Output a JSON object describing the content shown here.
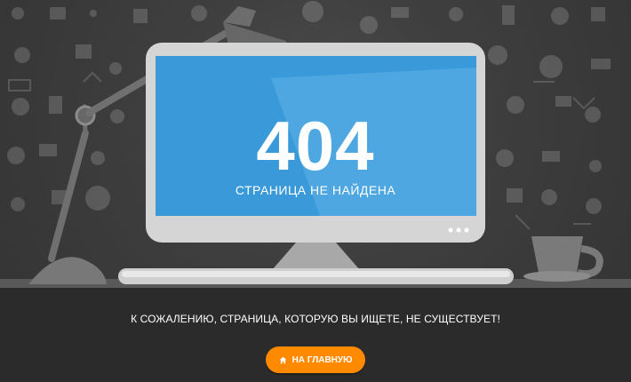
{
  "error": {
    "code": "404",
    "subtitle": "СТРАНИЦА НЕ НАЙДЕНА",
    "message": "К СОЖАЛЕНИЮ, СТРАНИЦА, КОТОРУЮ ВЫ ИЩЕТЕ, НЕ СУЩЕСТВУЕТ!"
  },
  "actions": {
    "home_label": "НА ГЛАВНУЮ"
  },
  "icons": {
    "home_button_icon": "home-icon",
    "background_icons": "decorative-icon-pattern"
  },
  "colors": {
    "accent": "#ff8a00",
    "screen_blue": "#3a9ad9",
    "hero_background": "#404040",
    "bottom_background": "#2b2b2b"
  }
}
